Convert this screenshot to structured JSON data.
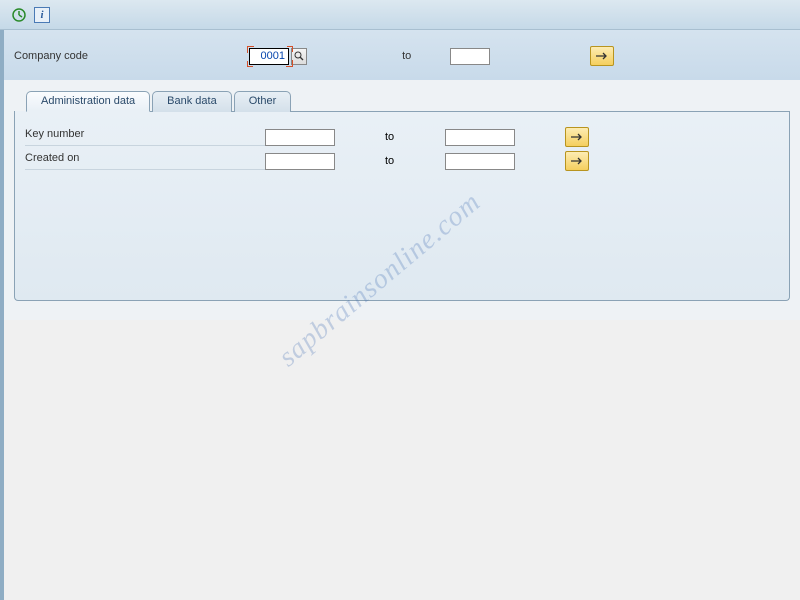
{
  "toolbar": {
    "execute_icon": "execute",
    "info_icon": "info"
  },
  "selection": {
    "company_code_label": "Company code",
    "company_code_value": "0001",
    "to_label": "to",
    "company_code_to_value": ""
  },
  "tabs": [
    {
      "label": "Administration data",
      "active": true
    },
    {
      "label": "Bank data",
      "active": false
    },
    {
      "label": "Other",
      "active": false
    }
  ],
  "admin_data": {
    "rows": [
      {
        "label": "Key number",
        "from": "",
        "to_label": "to",
        "to": ""
      },
      {
        "label": "Created on",
        "from": "",
        "to_label": "to",
        "to": ""
      }
    ]
  },
  "watermark": "sapbrainsonline.com"
}
